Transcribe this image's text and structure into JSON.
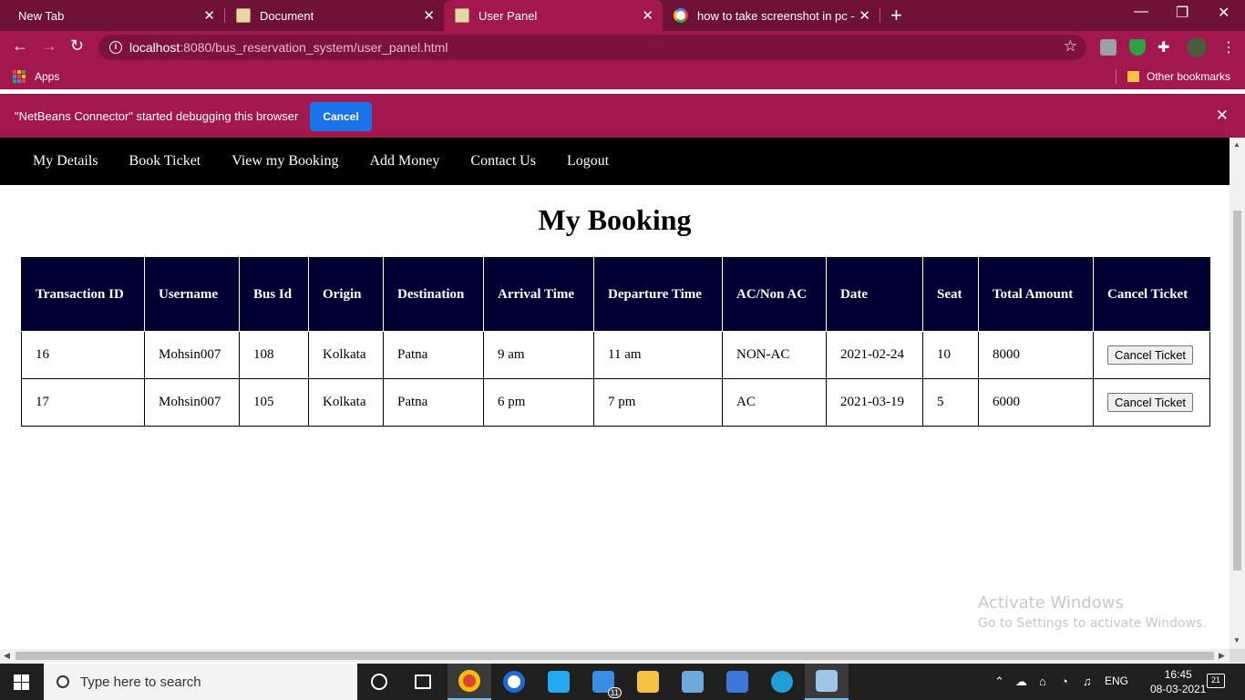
{
  "browser": {
    "tabs": [
      {
        "title": "New Tab"
      },
      {
        "title": "Document"
      },
      {
        "title": "User Panel"
      },
      {
        "title": "how to take screenshot in pc - Go"
      }
    ],
    "url_host": "localhost",
    "url_path": ":8080/bus_reservation_system/user_panel.html",
    "bookmarks": {
      "apps": "Apps",
      "other": "Other bookmarks"
    },
    "infobar": {
      "message": "\"NetBeans Connector\" started debugging this browser",
      "cancel": "Cancel"
    },
    "accent_color": "#a3174f"
  },
  "site_nav": {
    "items": [
      "My Details",
      "Book Ticket",
      "View my Booking",
      "Add Money",
      "Contact Us",
      "Logout"
    ]
  },
  "page": {
    "title": "My Booking",
    "table": {
      "headers": [
        "Transaction ID",
        "Username",
        "Bus Id",
        "Origin",
        "Destination",
        "Arrival Time",
        "Departure Time",
        "AC/Non AC",
        "Date",
        "Seat",
        "Total Amount",
        "Cancel Ticket"
      ],
      "rows": [
        {
          "id": "16",
          "username": "Mohsin007",
          "bus": "108",
          "origin": "Kolkata",
          "dest": "Patna",
          "arrival": "9 am",
          "departure": "11 am",
          "ac": "NON-AC",
          "date": "2021-02-24",
          "seat": "10",
          "amount": "8000",
          "action": "Cancel Ticket"
        },
        {
          "id": "17",
          "username": "Mohsin007",
          "bus": "105",
          "origin": "Kolkata",
          "dest": "Patna",
          "arrival": "6 pm",
          "departure": "7 pm",
          "ac": "AC",
          "date": "2021-03-19",
          "seat": "5",
          "amount": "6000",
          "action": "Cancel Ticket"
        }
      ]
    }
  },
  "watermark": {
    "line1": "Activate Windows",
    "line2": "Go to Settings to activate Windows."
  },
  "taskbar": {
    "search_placeholder": "Type here to search",
    "mail_badge": "11",
    "lang": "ENG",
    "time": "16:45",
    "date": "08-03-2021",
    "notif_count": "21"
  }
}
